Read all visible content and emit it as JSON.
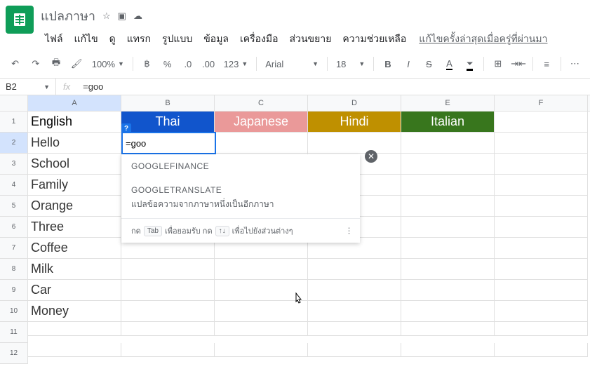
{
  "doc": {
    "title": "แปลภาษา"
  },
  "menu": {
    "file": "ไฟล์",
    "edit": "แก้ไข",
    "view": "ดู",
    "insert": "แทรก",
    "format": "รูปแบบ",
    "data": "ข้อมูล",
    "tools": "เครื่องมือ",
    "addons": "ส่วนขยาย",
    "help": "ความช่วยเหลือ",
    "lastEdit": "แก้ไขครั้งล่าสุดเมื่อครู่ที่ผ่านมา"
  },
  "toolbar": {
    "zoom": "100%",
    "num": "123",
    "font": "Arial",
    "size": "18"
  },
  "formula": {
    "cellRef": "B2",
    "value": "=goo"
  },
  "columns": [
    "A",
    "B",
    "C",
    "D",
    "E",
    "F"
  ],
  "rows": [
    "1",
    "2",
    "3",
    "4",
    "5",
    "6",
    "7",
    "8",
    "9",
    "10",
    "11",
    "12"
  ],
  "headers": {
    "en": "English",
    "th": "Thai",
    "jp": "Japanese",
    "hi": "Hindi",
    "it": "Italian"
  },
  "colA": [
    "Hello",
    "School",
    "Family",
    "Orange",
    "Three",
    "Coffee",
    "Milk",
    "Car",
    "Money"
  ],
  "activeCell": {
    "value": "=goo",
    "badge": "?"
  },
  "autocomplete": {
    "items": [
      {
        "name": "GOOGLEFINANCE",
        "desc": ""
      },
      {
        "name": "GOOGLETRANSLATE",
        "desc": "แปลข้อความจากภาษาหนึ่งเป็นอีกภาษา"
      }
    ],
    "hintPrefix": "กด",
    "tabKey": "Tab",
    "hintMid": "เพื่อยอมรับ กด",
    "arrowKeys": "↑↓",
    "hintEnd": "เพื่อไปยังส่วนต่างๆ"
  }
}
